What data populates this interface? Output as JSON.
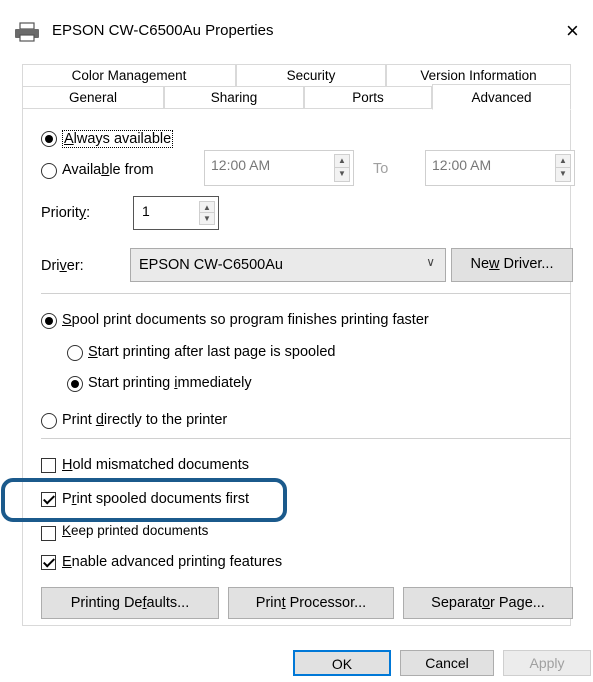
{
  "window": {
    "title": "EPSON CW-C6500Au Properties",
    "close_icon": "×"
  },
  "tabs_row1": [
    {
      "label": "Color Management"
    },
    {
      "label": "Security"
    },
    {
      "label": "Version Information"
    }
  ],
  "tabs_row2": [
    {
      "label": "General"
    },
    {
      "label": "Sharing"
    },
    {
      "label": "Ports"
    },
    {
      "label": "Advanced",
      "active": true
    }
  ],
  "availability": {
    "always_label_pre": "",
    "always_label_u": "A",
    "always_label_post": "lways available",
    "from_label_pre": "Availa",
    "from_label_u": "b",
    "from_label_post": "le from",
    "from_time": "12:00 AM",
    "to_label": "To",
    "to_time": "12:00 AM"
  },
  "priority": {
    "label_pre": "Priorit",
    "label_u": "y",
    "label_post": ":",
    "value": "1"
  },
  "driver": {
    "label_pre": "Dri",
    "label_u": "v",
    "label_post": "er:",
    "selected": "EPSON CW-C6500Au",
    "new_driver_pre": "Ne",
    "new_driver_u": "w",
    "new_driver_post": " Driver..."
  },
  "spool": {
    "spool_pre": "",
    "spool_u": "S",
    "spool_post": "pool print documents so program finishes printing faster",
    "after_last_pre": "",
    "after_last_u": "S",
    "after_last_post": "tart printing after last page is spooled",
    "immediately_pre": "Start printing ",
    "immediately_u": "i",
    "immediately_post": "mmediately",
    "direct_pre": "Print ",
    "direct_u": "d",
    "direct_post": "irectly to the printer"
  },
  "options": {
    "hold_pre": "",
    "hold_u": "H",
    "hold_post": "old mismatched documents",
    "spooled_first_pre": "P",
    "spooled_first_u": "r",
    "spooled_first_post": "int spooled documents first",
    "keep_pre": "",
    "keep_u": "K",
    "keep_post": "eep printed documents",
    "advanced_pre": "",
    "advanced_u": "E",
    "advanced_post": "nable advanced printing features"
  },
  "buttons": {
    "defaults_pre": "Printing De",
    "defaults_u": "f",
    "defaults_post": "aults...",
    "processor_pre": "Prin",
    "processor_u": "t",
    "processor_post": " Processor...",
    "separator_pre": "Separat",
    "separator_u": "o",
    "separator_post": "r Page..."
  },
  "footer": {
    "ok": "OK",
    "cancel": "Cancel",
    "apply": "Apply"
  },
  "colors": {
    "highlight": "#1b5a8c",
    "disabled_text": "#a0a0a0",
    "button_bg": "#e1e1e1"
  }
}
